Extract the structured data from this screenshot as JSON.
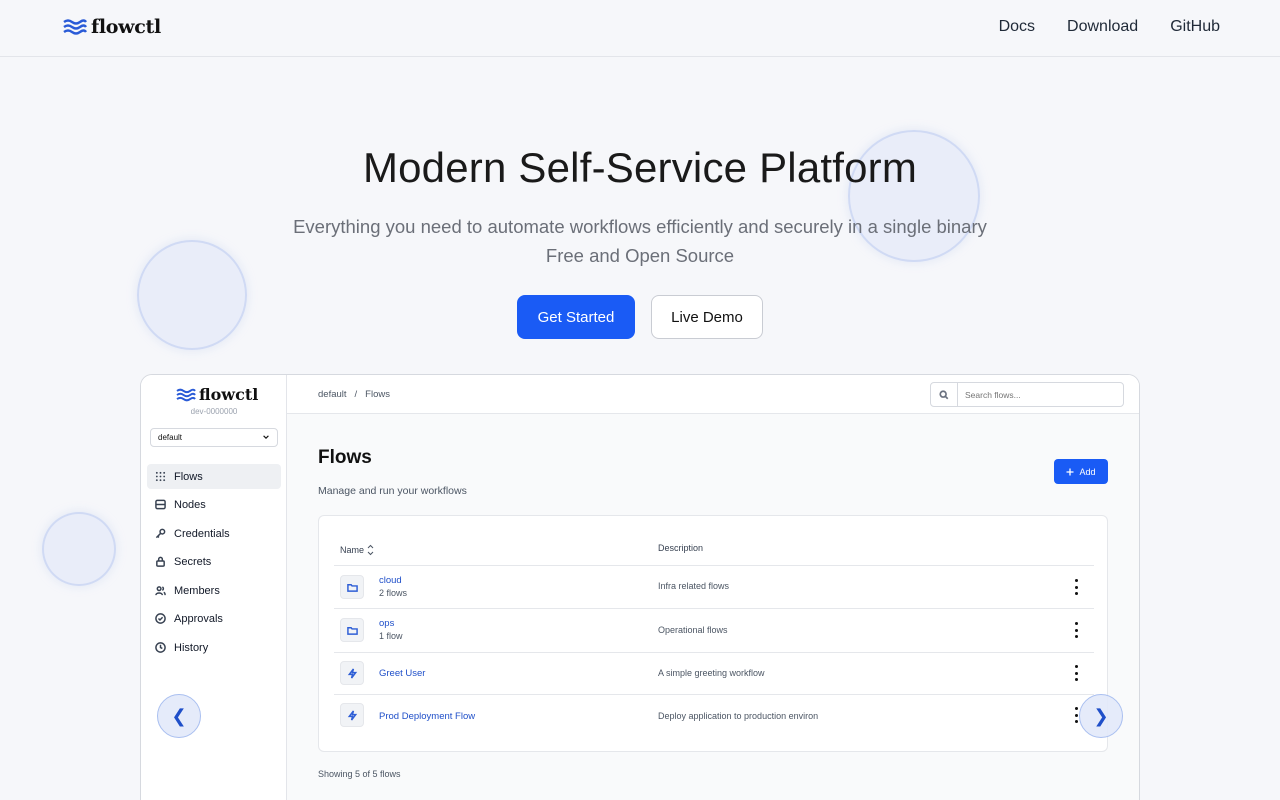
{
  "site": {
    "brand": "flowctl",
    "nav": [
      "Docs",
      "Download",
      "GitHub"
    ]
  },
  "hero": {
    "title": "Modern Self-Service Platform",
    "subtitle_line1": "Everything you need to automate workflows efficiently and securely in a single binary",
    "subtitle_line2": "Free and Open Source",
    "primary_cta": "Get Started",
    "secondary_cta": "Live Demo"
  },
  "app": {
    "brand": "flowctl",
    "env": "dev-0000000",
    "namespace": "default",
    "sidebar": [
      {
        "label": "Flows",
        "icon": "grid-icon",
        "active": true
      },
      {
        "label": "Nodes",
        "icon": "server-icon"
      },
      {
        "label": "Credentials",
        "icon": "key-icon"
      },
      {
        "label": "Secrets",
        "icon": "lock-icon"
      },
      {
        "label": "Members",
        "icon": "users-icon"
      },
      {
        "label": "Approvals",
        "icon": "check-circle-icon"
      },
      {
        "label": "History",
        "icon": "clock-icon"
      }
    ],
    "breadcrumb": [
      "default",
      "/",
      "Flows"
    ],
    "search_placeholder": "Search flows...",
    "page_title": "Flows",
    "page_desc": "Manage and run your workflows",
    "add_label": "Add",
    "columns": {
      "name": "Name",
      "description": "Description"
    },
    "rows": [
      {
        "name": "cloud",
        "count": "2 flows",
        "description": "Infra related flows",
        "icon": "folder-icon"
      },
      {
        "name": "ops",
        "count": "1 flow",
        "description": "Operational flows",
        "icon": "folder-icon"
      },
      {
        "name": "Greet User",
        "count": "",
        "description": "A simple greeting workflow",
        "icon": "lightning-icon"
      },
      {
        "name": "Prod Deployment Flow",
        "count": "",
        "description": "Deploy application to production environ",
        "icon": "lightning-icon"
      }
    ],
    "footer": "Showing 5 of 5 flows"
  },
  "carousel": {
    "prev": "❮",
    "next": "❯"
  },
  "colors": {
    "accent": "#1a5bf5",
    "link": "#1f4fc9",
    "background": "#f6f7fa"
  }
}
